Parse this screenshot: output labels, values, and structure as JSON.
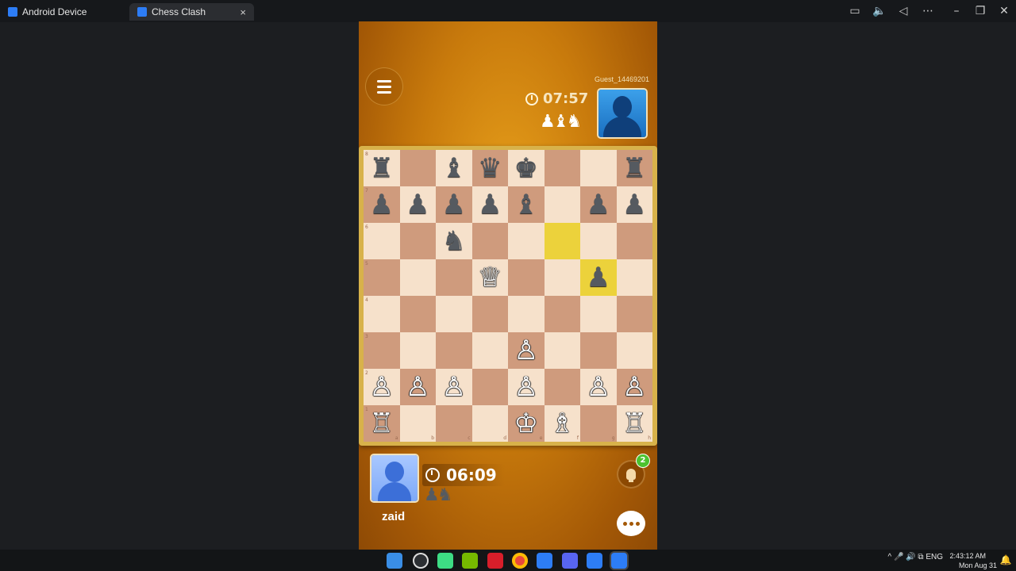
{
  "window": {
    "tabs": [
      {
        "label": "Android Device"
      },
      {
        "label": "Chess Clash"
      }
    ],
    "controls": [
      "screen-cast-icon",
      "volume-icon",
      "back-icon",
      "more-icon",
      "minimize-icon",
      "restore-icon",
      "close-icon"
    ]
  },
  "opponent": {
    "name": "Guest_14469201",
    "timer": "07:57",
    "captured": "♟♝♞"
  },
  "player": {
    "name": "zaid",
    "timer": "06:09",
    "captured": "♟♞"
  },
  "hint": {
    "badge": "2"
  },
  "board": {
    "ranks": [
      "8",
      "7",
      "6",
      "5",
      "4",
      "3",
      "2",
      "1"
    ],
    "files": [
      "a",
      "b",
      "c",
      "d",
      "e",
      "f",
      "g",
      "h"
    ],
    "highlighted": [
      "f6",
      "g5"
    ],
    "rows": [
      [
        [
          "♜",
          "b"
        ],
        null,
        [
          "♝",
          "b"
        ],
        [
          "♛",
          "b"
        ],
        [
          "♚",
          "b"
        ],
        null,
        null,
        [
          "♜",
          "b"
        ]
      ],
      [
        [
          "♟",
          "b"
        ],
        [
          "♟",
          "b"
        ],
        [
          "♟",
          "b"
        ],
        [
          "♟",
          "b"
        ],
        [
          "♝",
          "b"
        ],
        null,
        [
          "♟",
          "b"
        ],
        [
          "♟",
          "b"
        ]
      ],
      [
        null,
        null,
        [
          "♞",
          "b"
        ],
        null,
        null,
        null,
        null,
        null
      ],
      [
        null,
        null,
        null,
        [
          "♕",
          "w"
        ],
        null,
        null,
        [
          "♟",
          "b"
        ],
        null
      ],
      [
        null,
        null,
        null,
        null,
        null,
        null,
        null,
        null
      ],
      [
        null,
        null,
        null,
        null,
        [
          "♙",
          "w"
        ],
        null,
        null,
        null
      ],
      [
        [
          "♙",
          "w"
        ],
        [
          "♙",
          "w"
        ],
        [
          "♙",
          "w"
        ],
        null,
        [
          "♙",
          "w"
        ],
        null,
        [
          "♙",
          "w"
        ],
        [
          "♙",
          "w"
        ]
      ],
      [
        [
          "♖",
          "w"
        ],
        null,
        null,
        null,
        [
          "♔",
          "w"
        ],
        [
          "♗",
          "w"
        ],
        null,
        [
          "♖",
          "w"
        ]
      ]
    ]
  },
  "taskbar": {
    "tray": "^ 🎤 🔊 ⧉ ENG",
    "time": "2:43:12 AM",
    "date": "Mon Aug 31"
  }
}
